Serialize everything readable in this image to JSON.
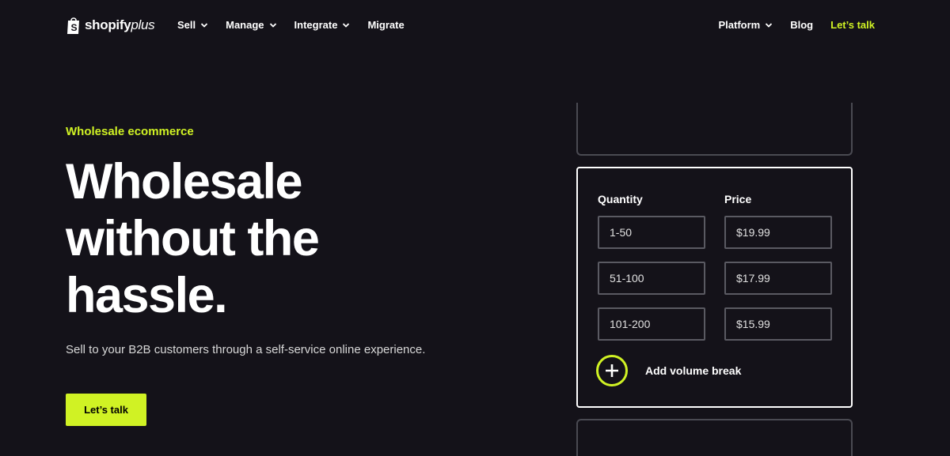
{
  "header": {
    "logo": {
      "text": "shopify",
      "plus": "plus"
    },
    "nav_left": [
      {
        "label": "Sell",
        "dropdown": true
      },
      {
        "label": "Manage",
        "dropdown": true
      },
      {
        "label": "Integrate",
        "dropdown": true
      },
      {
        "label": "Migrate",
        "dropdown": false
      }
    ],
    "nav_right": [
      {
        "label": "Platform",
        "dropdown": true
      },
      {
        "label": "Blog",
        "dropdown": false
      },
      {
        "label": "Let’s talk",
        "dropdown": false,
        "accent": true
      }
    ]
  },
  "hero": {
    "eyebrow": "Wholesale ecommerce",
    "headline_lines": [
      "Wholesale",
      "without the",
      "hassle."
    ],
    "subtext": "Sell to your B2B customers through a self-service online experience.",
    "cta_label": "Let’s talk"
  },
  "pricing_card": {
    "quantity_header": "Quantity",
    "price_header": "Price",
    "rows": [
      {
        "quantity": "1-50",
        "price": "$19.99"
      },
      {
        "quantity": "51-100",
        "price": "$17.99"
      },
      {
        "quantity": "101-200",
        "price": "$15.99"
      }
    ],
    "add_label": "Add volume break"
  },
  "colors": {
    "background": "#141219",
    "accent": "#d0f224",
    "text": "#ffffff"
  }
}
